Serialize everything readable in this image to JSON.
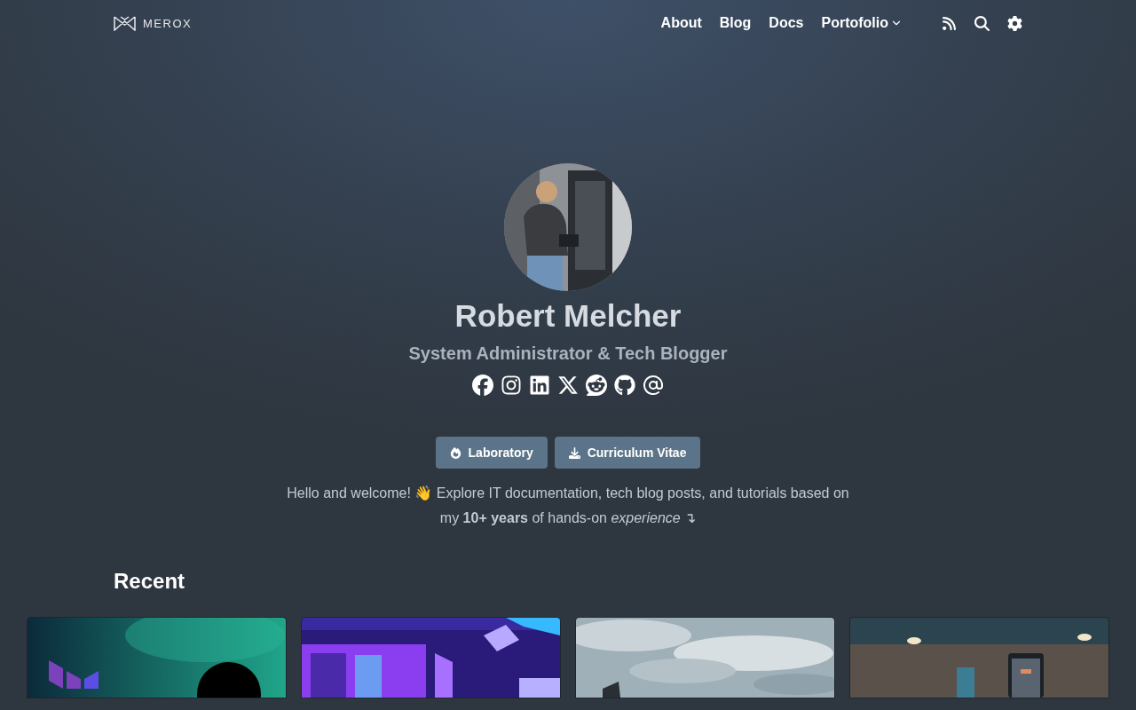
{
  "brand": "MEROX",
  "nav": [
    {
      "label": "About",
      "kind": "link"
    },
    {
      "label": "Blog",
      "kind": "link"
    },
    {
      "label": "Docs",
      "kind": "link"
    },
    {
      "label": "Portofolio",
      "kind": "dropdown"
    }
  ],
  "profile": {
    "name": "Robert Melcher",
    "title": "System Administrator & Tech Blogger"
  },
  "buttons": [
    {
      "label": "Laboratory"
    },
    {
      "label": "Curriculum Vitae"
    }
  ],
  "intro": [
    "Hello and welcome! 👋 Explore IT documentation, tech blog posts, and tutorials based on",
    "my **10+ years** of hands-on *experience* ↴"
  ],
  "recent": {
    "heading": "Recent",
    "cards": [
      {
        "kind": "logos"
      },
      {
        "kind": "server"
      },
      {
        "kind": "sky"
      },
      {
        "kind": "room"
      }
    ]
  }
}
